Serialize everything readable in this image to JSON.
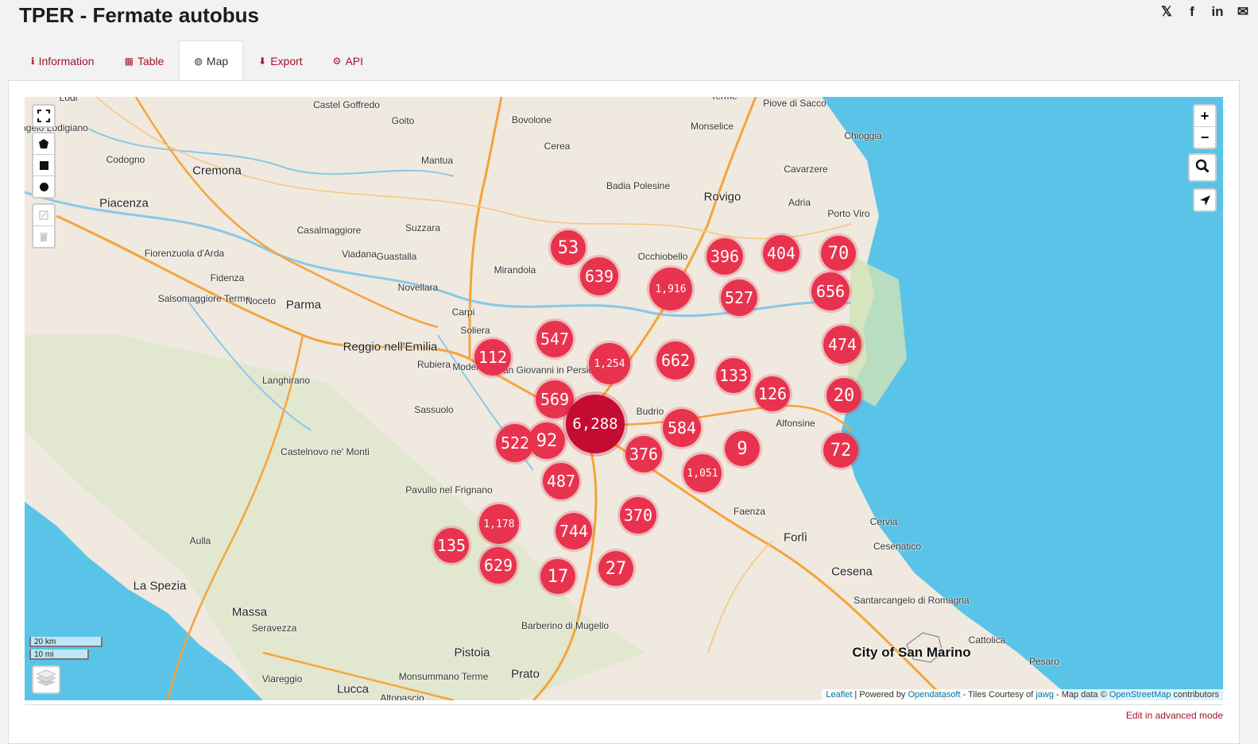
{
  "page": {
    "title": "TPER - Fermate autobus"
  },
  "share": {
    "x_label": "𝕏",
    "facebook_label": "f",
    "linkedin_label": "in",
    "email_label": "✉"
  },
  "tabs": [
    {
      "label": "Information",
      "icon": "info-circle-icon",
      "glyph": "ℹ"
    },
    {
      "label": "Table",
      "icon": "table-icon",
      "glyph": "▦"
    },
    {
      "label": "Map",
      "icon": "globe-icon",
      "glyph": "◍"
    },
    {
      "label": "Export",
      "icon": "download-icon",
      "glyph": "⬇"
    },
    {
      "label": "API",
      "icon": "cogs-icon",
      "glyph": "⚙"
    }
  ],
  "map": {
    "colors": {
      "sea": "#5ac3e8",
      "land": "#efe9df",
      "cluster": "#e8334f",
      "cluster_dark": "#c40b31",
      "road": "#f6a33b"
    },
    "places": [
      "Lodi",
      "Castel Goffredo",
      "Goito",
      "Bovolone",
      "Terme",
      "Piove di Sacco",
      "Monselice",
      "Chioggia",
      "Sant'Angelo Lodigiano",
      "Codogno",
      "Cremona",
      "Mantua",
      "Cerea",
      "Badia Polesine",
      "Rovigo",
      "Cavarzere",
      "Adria",
      "Porto Viro",
      "Piacenza",
      "Casalmaggiore",
      "Suzzara",
      "Fiorenzuola d'Arda",
      "Viadana",
      "Guastalla",
      "Mirandola",
      "Occhiobello",
      "Fidenza",
      "Salsomaggiore Terme",
      "Noceto",
      "Parma",
      "Novellara",
      "Carpi",
      "Soliera",
      "Reggio nell'Emilia",
      "Rubiera",
      "Modena",
      "San Giovanni in Persiceto",
      "Langhirano",
      "Sassuolo",
      "Budrio",
      "Alfonsine",
      "Castelnovo ne' Monti",
      "Pavullo nel Frignano",
      "Faenza",
      "Forlì",
      "Aulla",
      "Cervia",
      "Cesenatico",
      "Cesena",
      "La Spezia",
      "Massa",
      "Seravezza",
      "Santarcangelo di Romagna",
      "Barberino di Mugello",
      "Cattolica",
      "City of San Marino",
      "Pesaro",
      "Pistoia",
      "Prato",
      "Lucca",
      "Viareggio",
      "Monsummano Terme",
      "Altopascio"
    ],
    "clusters": [
      "53",
      "639",
      "1,916",
      "396",
      "404",
      "70",
      "527",
      "656",
      "547",
      "112",
      "1,254",
      "662",
      "474",
      "133",
      "126",
      "20",
      "569",
      "6,288",
      "584",
      "9",
      "72",
      "522",
      "92",
      "376",
      "1,051",
      "487",
      "370",
      "1,178",
      "744",
      "135",
      "629",
      "17",
      "27"
    ],
    "controls": {
      "zoom_in": "+",
      "zoom_out": "−",
      "search_icon": "search-icon",
      "locate_icon": "locate-icon",
      "fullscreen_icon": "fullscreen-icon",
      "layers_icon": "layers-icon"
    },
    "scale": {
      "km": "20 km",
      "mi": "10 mi"
    },
    "attribution": {
      "leaflet": "Leaflet",
      "powered": " | Powered by ",
      "ods": "Opendatasoft",
      "tiles": " - Tiles Courtesy of ",
      "jawg": "jawg",
      "mapdata": " - Map data © ",
      "osm": "OpenStreetMap",
      "contrib": " contributors"
    }
  },
  "footer": {
    "advanced_link": "Edit in advanced mode"
  }
}
